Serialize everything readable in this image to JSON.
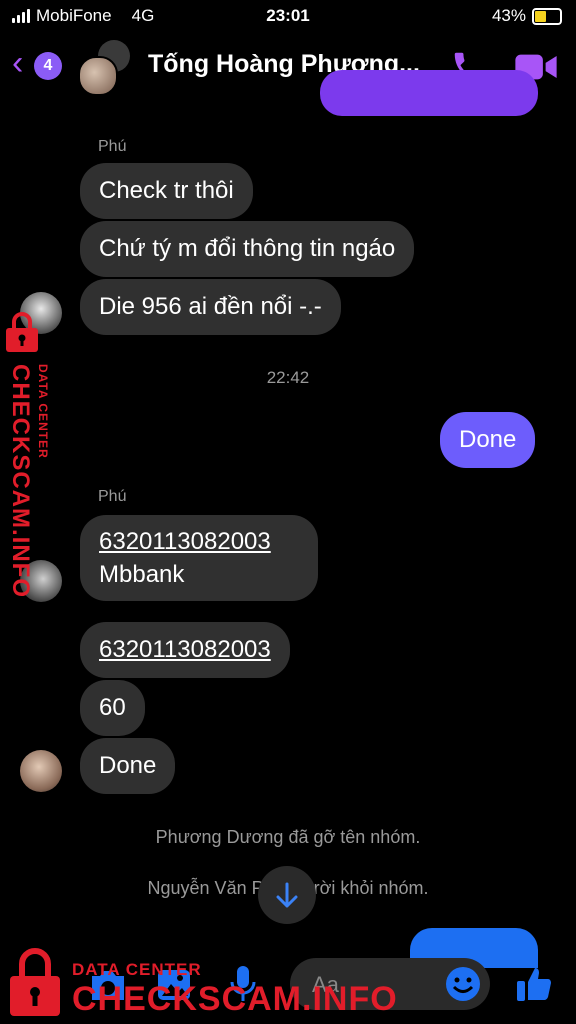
{
  "status_bar": {
    "carrier": "MobiFone",
    "network": "4G",
    "time": "23:01",
    "battery": "43%"
  },
  "header": {
    "back_count": "4",
    "title": "Tống Hoàng Phương..."
  },
  "messages": {
    "sender1": "Phú",
    "m1": "Check tr thôi",
    "m2": "Chứ tý m đổi thông tin ngáo",
    "m3": "Die 956 ai đền nổi -.-",
    "timestamp": "22:42",
    "out1": "Done",
    "sender2": "Phú",
    "m4_account": "6320113082003",
    "m4_bank": "Mbbank",
    "m5": "6320113082003",
    "m6": "60",
    "m7": "Done",
    "sys1": "Phương Dương đã gỡ tên nhóm.",
    "sys2": "Nguyễn Văn Phú đã rời khỏi nhóm."
  },
  "composer": {
    "placeholder": "Aa"
  },
  "watermark": {
    "small": "DATA CENTER",
    "big": "CHECKSCAM.INFO"
  },
  "colors": {
    "accent": "#a855f7",
    "outgoing": "#6d5dfc",
    "incoming": "#303030",
    "watermark": "#e11d2a",
    "blue": "#1d6ff2"
  }
}
